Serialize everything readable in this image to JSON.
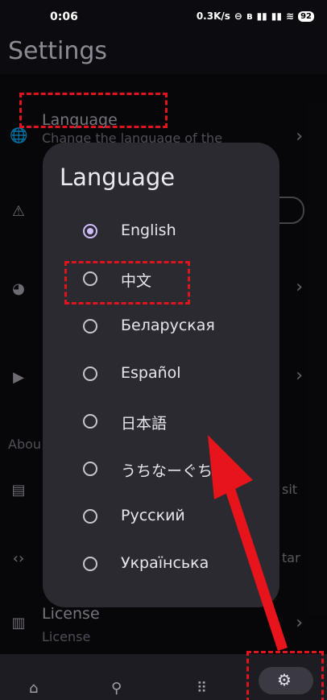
{
  "status_bar": {
    "time": "0:06",
    "network_speed": "0.3K/s",
    "battery": "92"
  },
  "header": {
    "title": "Settings"
  },
  "background": {
    "language_row": {
      "title": "Language",
      "subtitle": "Change the language of the"
    },
    "about_section": {
      "label": "Abou"
    },
    "about_row_1_tail": "sit",
    "about_row_2_tail": "tar",
    "license_row": {
      "title": "License",
      "subtitle": "License"
    }
  },
  "dialog": {
    "title": "Language",
    "options": [
      {
        "label": "English",
        "selected": true
      },
      {
        "label": "中文",
        "selected": false
      },
      {
        "label": "Беларуская",
        "selected": false
      },
      {
        "label": "Español",
        "selected": false
      },
      {
        "label": "日本語",
        "selected": false
      },
      {
        "label": "うちなーぐち",
        "selected": false
      },
      {
        "label": "Русский",
        "selected": false
      },
      {
        "label": "Українська",
        "selected": false
      }
    ]
  },
  "bottom_nav": {
    "items": [
      {
        "icon": "home-icon"
      },
      {
        "icon": "search-icon"
      },
      {
        "icon": "apps-grid-icon"
      },
      {
        "icon": "settings-gear-icon",
        "active": true
      }
    ]
  },
  "colors": {
    "accent": "#cfbdfe",
    "annotation": "#e0141c",
    "dialog_bg": "#2b2a30"
  }
}
